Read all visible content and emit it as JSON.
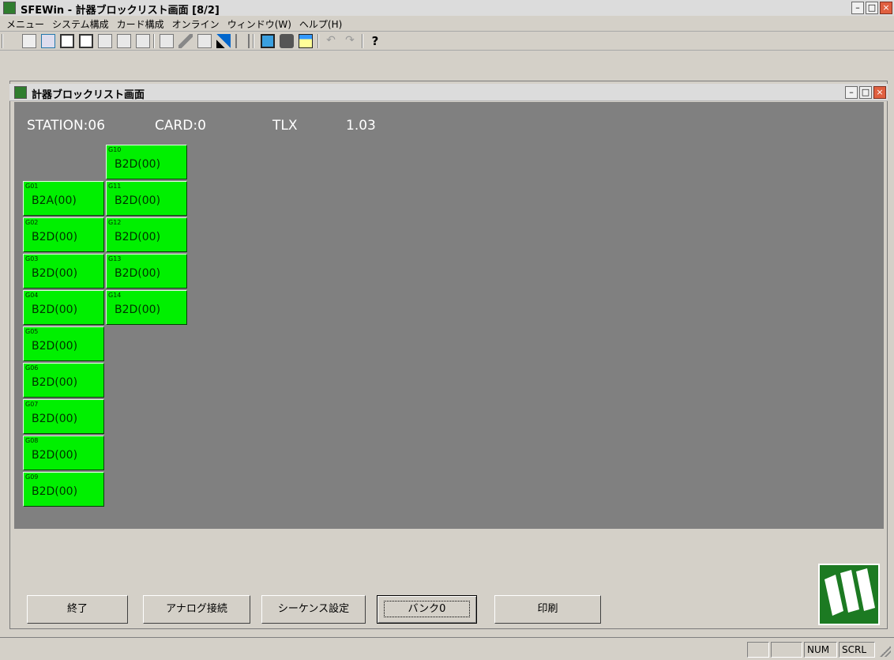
{
  "window": {
    "title": "SFEWin - 計器ブロックリスト画面 [8/2]"
  },
  "menu": [
    "メニュー",
    "システム構成",
    "カード構成",
    "オンライン",
    "ウィンドウ(W)",
    "ヘルプ(H)"
  ],
  "child_window": {
    "title": "計器ブロックリスト画面"
  },
  "info": {
    "station": "STATION:06",
    "card": "CARD:0",
    "type": "TLX",
    "version": "1.03"
  },
  "blocks_col1": [
    {
      "id": "G01",
      "label": "B2A(00)"
    },
    {
      "id": "G02",
      "label": "B2D(00)"
    },
    {
      "id": "G03",
      "label": "B2D(00)"
    },
    {
      "id": "G04",
      "label": "B2D(00)"
    },
    {
      "id": "G05",
      "label": "B2D(00)"
    },
    {
      "id": "G06",
      "label": "B2D(00)"
    },
    {
      "id": "G07",
      "label": "B2D(00)"
    },
    {
      "id": "G08",
      "label": "B2D(00)"
    },
    {
      "id": "G09",
      "label": "B2D(00)"
    }
  ],
  "blocks_col2": [
    {
      "id": "G10",
      "label": "B2D(00)"
    },
    {
      "id": "G11",
      "label": "B2D(00)"
    },
    {
      "id": "G12",
      "label": "B2D(00)"
    },
    {
      "id": "G13",
      "label": "B2D(00)"
    },
    {
      "id": "G14",
      "label": "B2D(00)"
    }
  ],
  "buttons": {
    "exit": "終了",
    "analog": "アナログ接続",
    "sequence": "シーケンス設定",
    "bank": "バンク0",
    "print": "印刷"
  },
  "status": {
    "num": "NUM",
    "scrl": "SCRL"
  },
  "colors": {
    "block": "#00f000",
    "canvas": "#808080"
  }
}
